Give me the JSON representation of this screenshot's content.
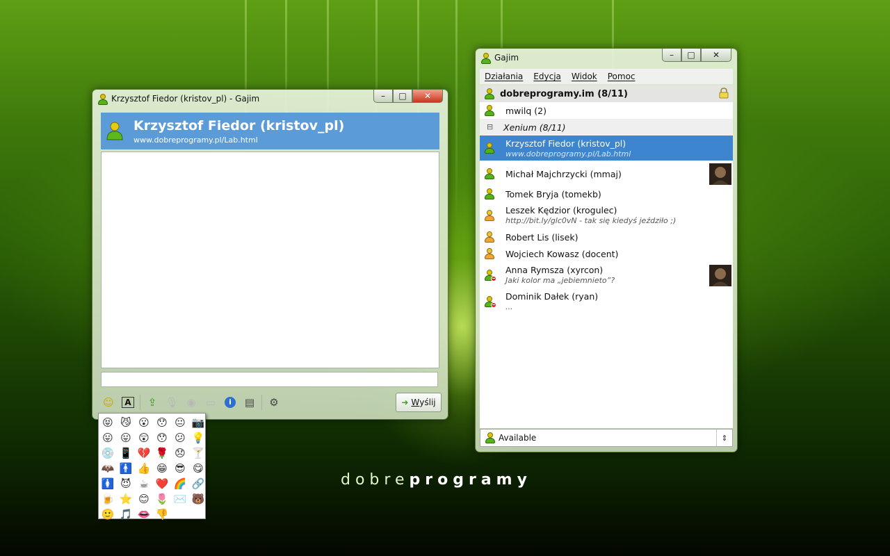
{
  "chat_window": {
    "title": "Krzysztof Fiedor (kristov_pl) - Gajim",
    "contact_name": "Krzysztof Fiedor (kristov_pl)",
    "contact_status": "www.dobreprogramy.pl/Lab.html",
    "message_input": {
      "value": "",
      "placeholder": ""
    },
    "send_label_underlined": "W",
    "send_label_rest": "yślij"
  },
  "roster_window": {
    "title": "Gajim",
    "menu": [
      "Działania",
      "Edycja",
      "Widok",
      "Pomoc"
    ],
    "account": "dobreprogramy.im (8/11)",
    "contacts_top": [
      {
        "name": "mwilq (2)",
        "status": "",
        "state": "online"
      }
    ],
    "group": "Xenium (8/11)",
    "contacts": [
      {
        "name": "Krzysztof Fiedor (kristov_pl)",
        "status": "www.dobreprogramy.pl/Lab.html",
        "state": "online",
        "selected": true
      },
      {
        "name": "Michał Majchrzycki (mmaj)",
        "status": "",
        "state": "online",
        "avatar": true
      },
      {
        "name": "Tomek Bryja (tomekb)",
        "status": "",
        "state": "online"
      },
      {
        "name": "Leszek Kędzior (krogulec)",
        "status": "http://bit.ly/glc0vN - tak się kiedyś jeździło ;)",
        "state": "away"
      },
      {
        "name": "Robert Lis (lisek)",
        "status": "",
        "state": "away"
      },
      {
        "name": "Wojciech Kowasz (docent)",
        "status": "",
        "state": "away"
      },
      {
        "name": "Anna Rymsza (xyrcon)",
        "status": "Jaki kolor ma „jebiemnieto”?",
        "state": "dnd",
        "avatar": true
      },
      {
        "name": "Dominik Dałek (ryan)",
        "status": "...",
        "state": "dnd"
      }
    ],
    "status_select": "Available"
  },
  "window_buttons": {
    "minimize": "–",
    "maximize": "□",
    "close": "✕"
  },
  "branding": {
    "part1": "dobre",
    "part2": "programy"
  },
  "colors": {
    "selection": "#3d86cf",
    "chat_header": "#5b9bd8",
    "online": "#57b21c",
    "away": "#f0a536",
    "dnd": "#d3261f"
  },
  "toolbar_icons": [
    "smiley-icon",
    "font-icon",
    "send-file-icon",
    "microphone-icon",
    "webcam-icon",
    "chat-bubble-icon",
    "info-icon",
    "history-icon",
    "settings-icon"
  ],
  "emoticons": [
    "😝",
    "😼",
    "😮",
    "😯",
    "😐",
    "📷",
    "😛",
    "😛",
    "😲",
    "😯",
    "😕",
    "💡",
    "💿",
    "📱",
    "💔",
    "🌹",
    "😞",
    "🍸",
    "🦇",
    "🚹",
    "👍",
    "😁",
    "😎",
    "😋",
    "🚺",
    "😈",
    "☕",
    "❤️",
    "🌈",
    "🔗",
    "🍺",
    "⭐",
    "😊",
    "🌷",
    "✉️",
    "🐻",
    "🙂",
    "🎵",
    "👄",
    "👎"
  ]
}
